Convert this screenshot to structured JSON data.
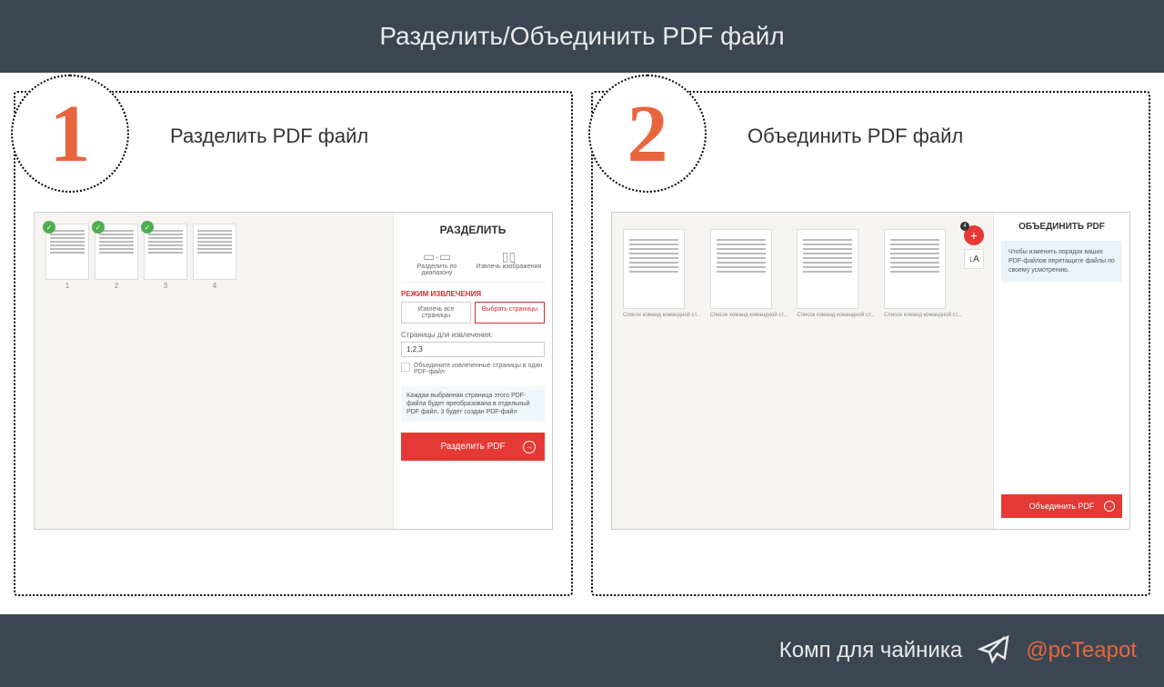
{
  "header": {
    "title": "Разделить/Объединить PDF файл"
  },
  "panels": {
    "left": {
      "number": "1",
      "title": "Разделить PDF файл",
      "sidebar_title": "РАЗДЕЛИТЬ",
      "mode1": "Разделить по диапазону",
      "mode2": "Извлечь изображения",
      "section_label": "РЕЖИМ ИЗВЛЕЧЕНИЯ",
      "tab1": "Извлечь все страницы",
      "tab2": "Выбрать страницы",
      "field_label": "Страницы для извлечения:",
      "input_value": "1,2,3",
      "checkbox_label": "Объедините извлеченные страницы в один PDF-файл",
      "info_text": "Каждая выбранная страница этого PDF-файла будет преобразована в отдельный PDF файл. 3 будет создан PDF-файл",
      "action": "Разделить PDF",
      "page_labels": [
        "1",
        "2",
        "3",
        "4"
      ]
    },
    "right": {
      "number": "2",
      "title": "Объединить PDF файл",
      "sidebar_title": "ОБЪЕДИНИТЬ PDF",
      "info_text": "Чтобы изменить порядок ваших PDF-файлов перетащите файлы по своему усмотрению.",
      "action": "Объединить PDF",
      "thumb_label": "Список команд командной ст...",
      "badge": "4"
    }
  },
  "footer": {
    "text": "Комп для чайника",
    "handle": "@pcTeapot"
  }
}
